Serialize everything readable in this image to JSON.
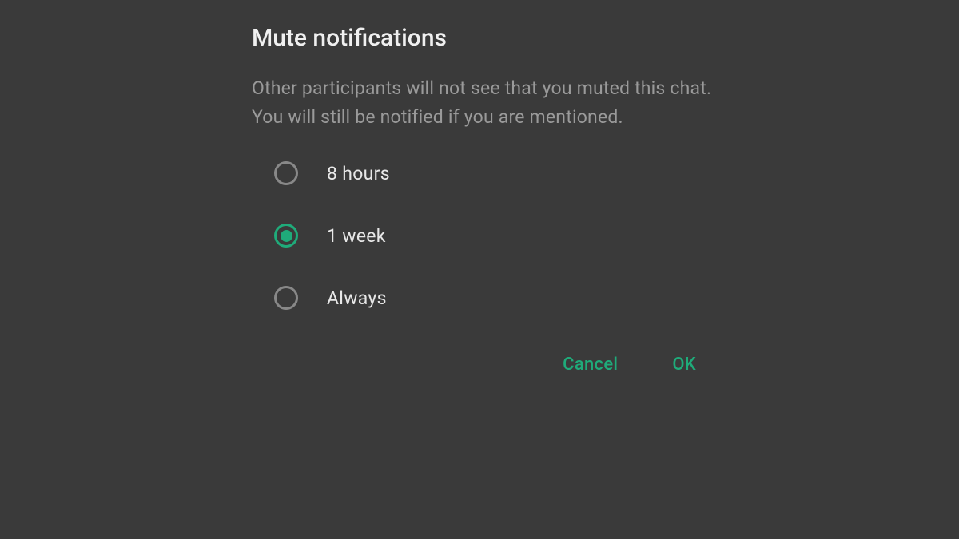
{
  "dialog": {
    "title": "Mute notifications",
    "description": "Other participants will not see that you muted this chat. You will still be notified if you are mentioned.",
    "options": [
      {
        "label": "8 hours",
        "selected": false
      },
      {
        "label": "1 week",
        "selected": true
      },
      {
        "label": "Always",
        "selected": false
      }
    ],
    "actions": {
      "cancel": "Cancel",
      "ok": "OK"
    }
  },
  "colors": {
    "background": "#3a3a3a",
    "accent": "#1fab7a",
    "textPrimary": "#f0f0f0",
    "textSecondary": "#9a9a9a"
  }
}
